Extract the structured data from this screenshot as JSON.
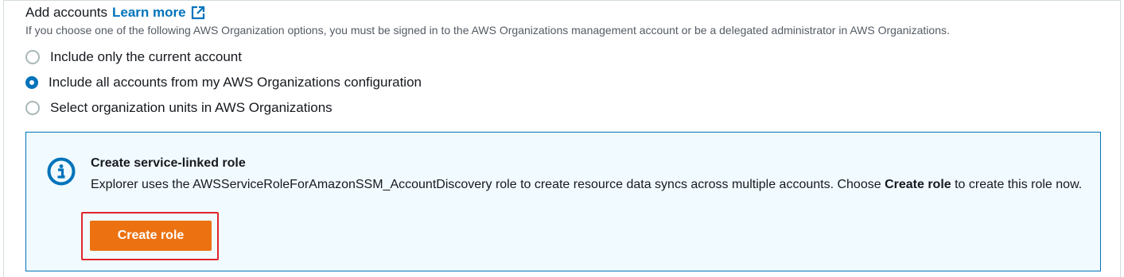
{
  "section": {
    "heading": "Add accounts",
    "learn_more": "Learn more",
    "description": "If you choose one of the following AWS Organization options, you must be signed in to the AWS Organizations management account or be a delegated administrator in AWS Organizations.",
    "options": [
      {
        "label": "Include only the current account",
        "selected": false
      },
      {
        "label": "Include all accounts from my AWS Organizations configuration",
        "selected": true
      },
      {
        "label": "Select organization units in AWS Organizations",
        "selected": false
      }
    ]
  },
  "info_alert": {
    "icon": "info-icon",
    "title": "Create service-linked role",
    "text_before": "Explorer uses the AWSServiceRoleForAmazonSSM_AccountDiscovery role to create resource data syncs across multiple accounts. Choose ",
    "text_bold": "Create role",
    "text_after": " to create this role now.",
    "button_label": "Create role"
  },
  "colors": {
    "link": "#0073bb",
    "radio_selected": "#0073bb",
    "alert_border": "#0073bb",
    "alert_background": "#f1faff",
    "button_primary": "#ec7211",
    "highlight_frame": "#e0262b"
  }
}
